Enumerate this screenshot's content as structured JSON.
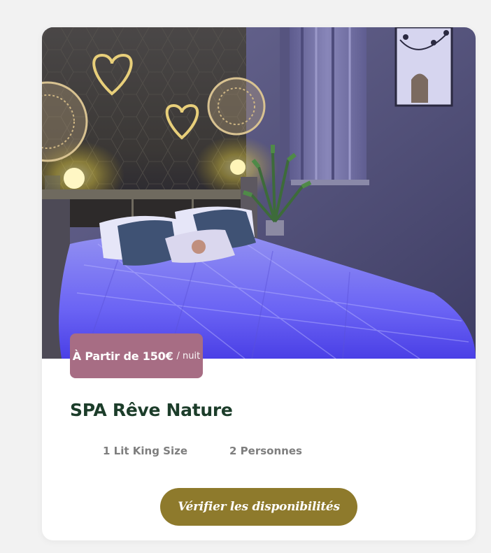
{
  "card": {
    "image_alt": "Chambre SPA Rêve Nature",
    "price": {
      "main": "À Partir de 150€",
      "unit": "/ nuit"
    },
    "title": "SPA Rêve Nature",
    "features": {
      "bed": "1 Lit King Size",
      "persons": "2 Personnes"
    },
    "cta_label": "Vérifier les disponibilités"
  },
  "colors": {
    "page_background": "#f2f2f2",
    "card_background": "#ffffff",
    "price_badge": "#a76d84",
    "title_text": "#1c3d2a",
    "feature_text": "#7e7e7e",
    "cta_button": "#8e7a2c"
  }
}
